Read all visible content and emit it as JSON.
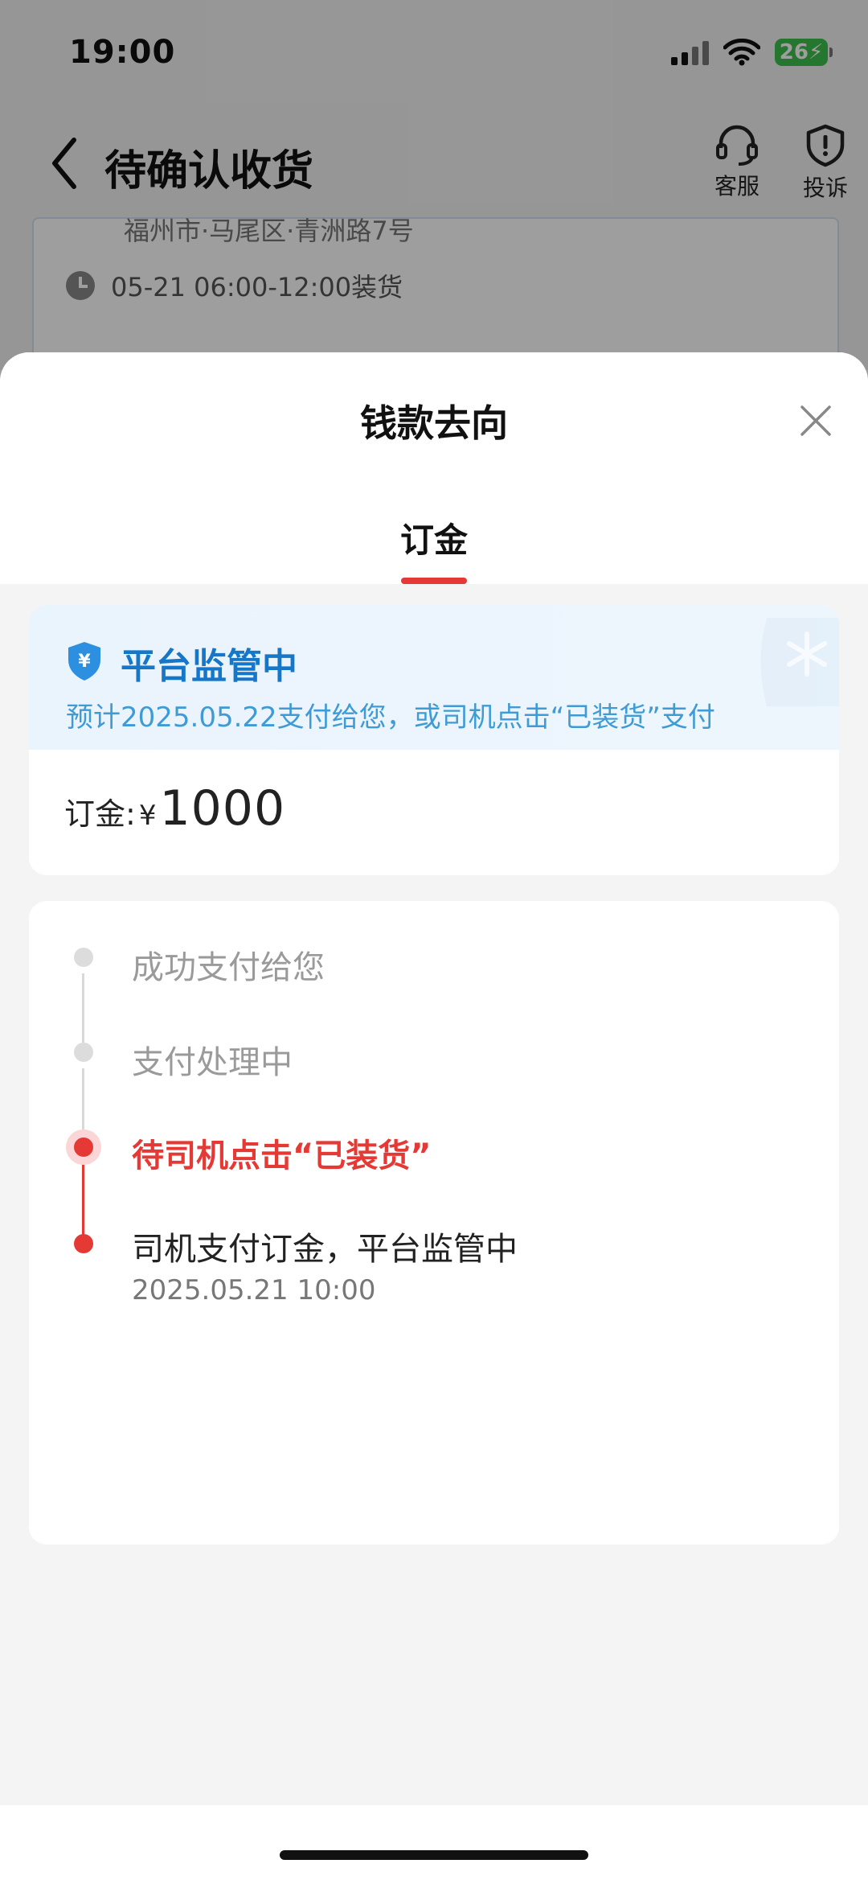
{
  "status_bar": {
    "time": "19:00",
    "battery": "26"
  },
  "nav": {
    "title": "待确认收货",
    "actions": {
      "service": "客服",
      "complaint": "投诉"
    }
  },
  "background": {
    "address": "福州市·马尾区·青洲路7号",
    "load_time": "05-21 06:00-12:00装货"
  },
  "sheet": {
    "title": "钱款去向",
    "tab": "订金",
    "escrow": {
      "title": "平台监管中",
      "desc": "预计2025.05.22支付给您，或司机点击“已装货”支付"
    },
    "amount": {
      "label": "订金:",
      "currency": "¥",
      "value": "1000"
    },
    "timeline": [
      {
        "text": "成功支付给您",
        "state": "pending"
      },
      {
        "text": "支付处理中",
        "state": "pending"
      },
      {
        "text": "待司机点击“已装货”",
        "state": "current"
      },
      {
        "text": "司机支付订金，平台监管中",
        "time": "2025.05.21 10:00",
        "state": "done"
      }
    ]
  },
  "colors": {
    "accent_red": "#e53935",
    "escrow_blue": "#1677c8",
    "pending_gray": "#d9d9d9"
  }
}
